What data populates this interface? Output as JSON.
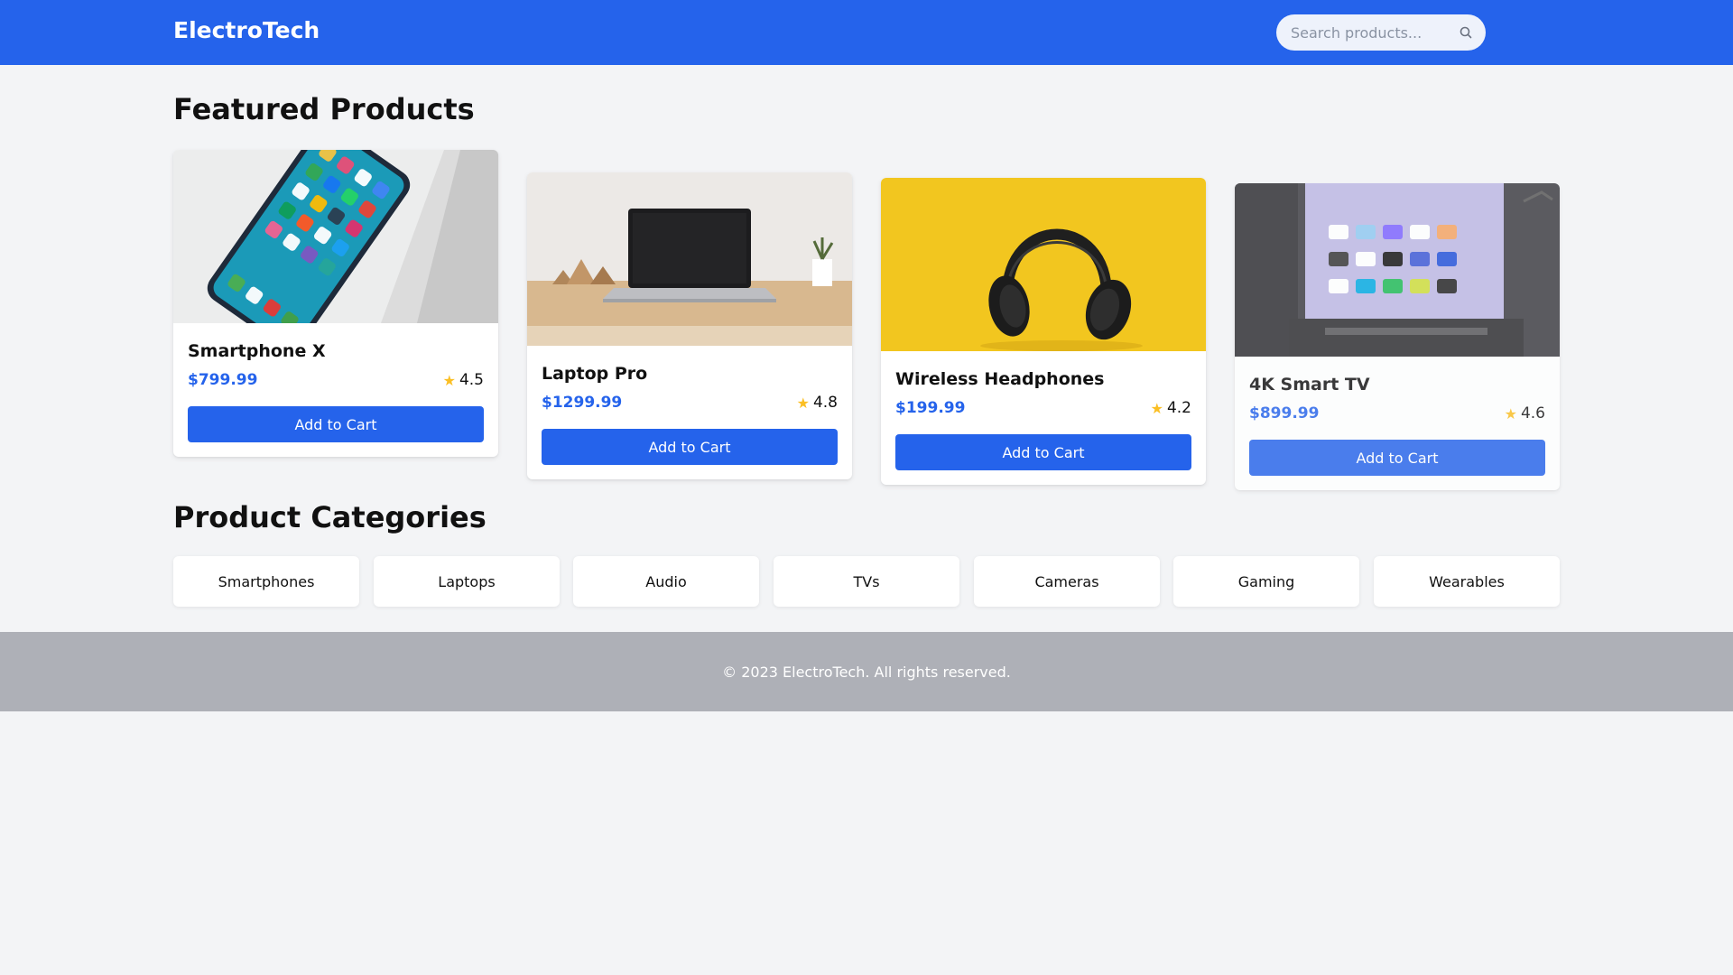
{
  "header": {
    "brand": "ElectroTech",
    "search_placeholder": "Search products..."
  },
  "featured": {
    "title": "Featured Products",
    "products": [
      {
        "name": "Smartphone X",
        "price": "$799.99",
        "rating": "4.5",
        "button": "Add to Cart",
        "image": "smartphone-photo"
      },
      {
        "name": "Laptop Pro",
        "price": "$1299.99",
        "rating": "4.8",
        "button": "Add to Cart",
        "image": "laptop-photo"
      },
      {
        "name": "Wireless Headphones",
        "price": "$199.99",
        "rating": "4.2",
        "button": "Add to Cart",
        "image": "headphones-photo"
      },
      {
        "name": "4K Smart TV",
        "price": "$899.99",
        "rating": "4.6",
        "button": "Add to Cart",
        "image": "smart-tv-photo"
      }
    ]
  },
  "categories": {
    "title": "Product Categories",
    "items": [
      "Smartphones",
      "Laptops",
      "Audio",
      "TVs",
      "Cameras",
      "Gaming",
      "Wearables"
    ]
  },
  "footer": {
    "text": "© 2023 ElectroTech. All rights reserved."
  },
  "colors": {
    "primary": "#2563eb",
    "star": "#fbbf24",
    "background": "#f3f4f6",
    "footer": "#aeb0b7"
  }
}
